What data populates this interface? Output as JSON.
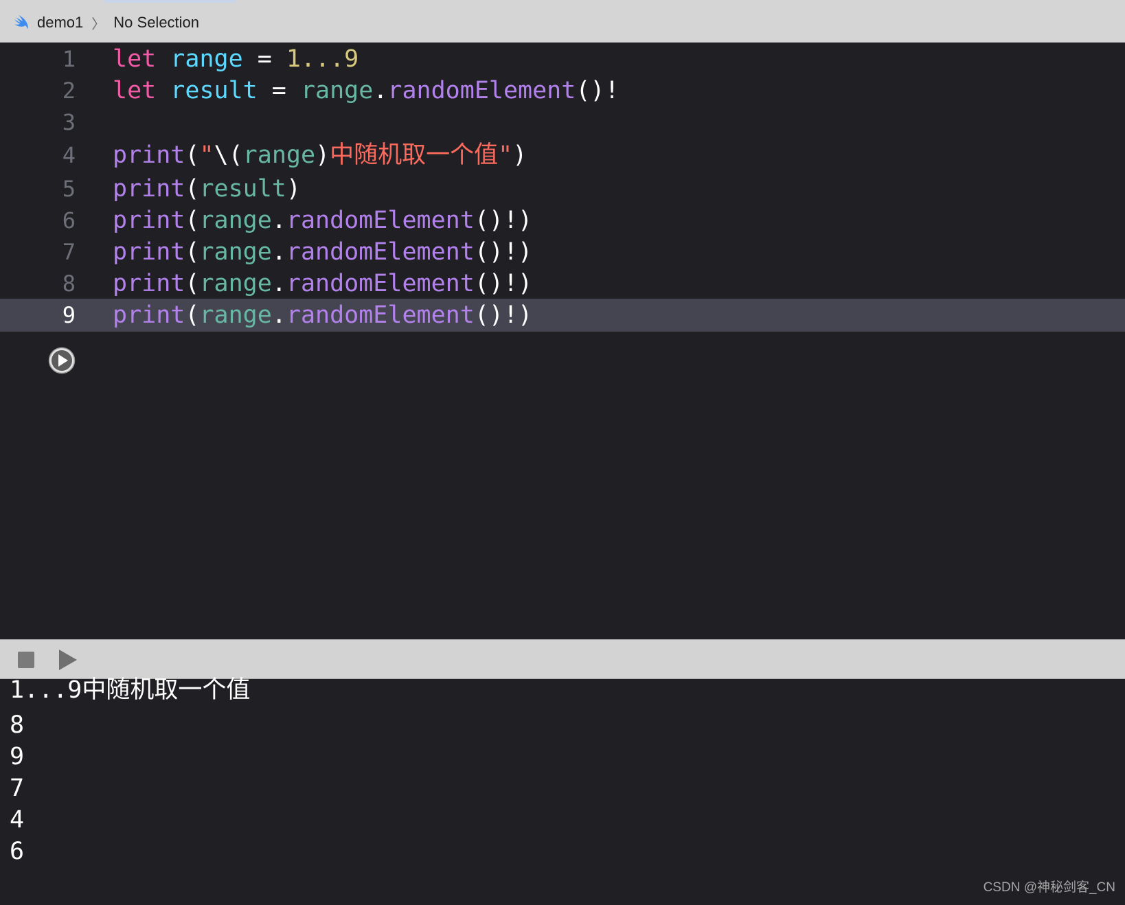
{
  "breadcrumb": {
    "icon": "swift-icon",
    "project": "demo1",
    "separator": "〉",
    "selection": "No Selection"
  },
  "editor": {
    "current_line": 9,
    "lines": [
      {
        "number": "1",
        "tokens": [
          {
            "t": "let",
            "c": "kw"
          },
          {
            "t": " ",
            "c": "plain"
          },
          {
            "t": "range",
            "c": "decl"
          },
          {
            "t": " = ",
            "c": "plain"
          },
          {
            "t": "1...9",
            "c": "num"
          }
        ]
      },
      {
        "number": "2",
        "tokens": [
          {
            "t": "let",
            "c": "kw"
          },
          {
            "t": " ",
            "c": "plain"
          },
          {
            "t": "result",
            "c": "decl"
          },
          {
            "t": " = ",
            "c": "plain"
          },
          {
            "t": "range",
            "c": "var"
          },
          {
            "t": ".",
            "c": "plain"
          },
          {
            "t": "randomElement",
            "c": "fn"
          },
          {
            "t": "()!",
            "c": "plain"
          }
        ]
      },
      {
        "number": "3",
        "tokens": []
      },
      {
        "number": "4",
        "tokens": [
          {
            "t": "print",
            "c": "fn"
          },
          {
            "t": "(",
            "c": "plain"
          },
          {
            "t": "\"",
            "c": "str"
          },
          {
            "t": "\\(",
            "c": "plain"
          },
          {
            "t": "range",
            "c": "var"
          },
          {
            "t": ")",
            "c": "plain"
          },
          {
            "t": "中随机取一个值\"",
            "c": "str"
          },
          {
            "t": ")",
            "c": "plain"
          }
        ]
      },
      {
        "number": "5",
        "tokens": [
          {
            "t": "print",
            "c": "fn"
          },
          {
            "t": "(",
            "c": "plain"
          },
          {
            "t": "result",
            "c": "var"
          },
          {
            "t": ")",
            "c": "plain"
          }
        ]
      },
      {
        "number": "6",
        "tokens": [
          {
            "t": "print",
            "c": "fn"
          },
          {
            "t": "(",
            "c": "plain"
          },
          {
            "t": "range",
            "c": "var"
          },
          {
            "t": ".",
            "c": "plain"
          },
          {
            "t": "randomElement",
            "c": "fn"
          },
          {
            "t": "()!)",
            "c": "plain"
          }
        ]
      },
      {
        "number": "7",
        "tokens": [
          {
            "t": "print",
            "c": "fn"
          },
          {
            "t": "(",
            "c": "plain"
          },
          {
            "t": "range",
            "c": "var"
          },
          {
            "t": ".",
            "c": "plain"
          },
          {
            "t": "randomElement",
            "c": "fn"
          },
          {
            "t": "()!)",
            "c": "plain"
          }
        ]
      },
      {
        "number": "8",
        "tokens": [
          {
            "t": "print",
            "c": "fn"
          },
          {
            "t": "(",
            "c": "plain"
          },
          {
            "t": "range",
            "c": "var"
          },
          {
            "t": ".",
            "c": "plain"
          },
          {
            "t": "randomElement",
            "c": "fn"
          },
          {
            "t": "()!)",
            "c": "plain"
          }
        ]
      },
      {
        "number": "9",
        "tokens": [
          {
            "t": "print",
            "c": "fn"
          },
          {
            "t": "(",
            "c": "plain"
          },
          {
            "t": "range",
            "c": "var"
          },
          {
            "t": ".",
            "c": "plain"
          },
          {
            "t": "randomElement",
            "c": "fn"
          },
          {
            "t": "()!)",
            "c": "plain"
          }
        ]
      }
    ]
  },
  "debug": {
    "stop_icon": "stop-icon",
    "run_icon": "play-icon"
  },
  "console": {
    "output": [
      "1...9中随机取一个值",
      "8",
      "9",
      "7",
      "4",
      "6"
    ]
  },
  "watermark": "CSDN @神秘剑客_CN",
  "colors": {
    "editor_bg": "#1f1f24",
    "keyword": "#f15aa4",
    "declaration": "#5dd8ff",
    "number": "#d9c97c",
    "variable": "#67b7a4",
    "function": "#b281eb",
    "string": "#fc6a5d",
    "current_line": "#444551"
  }
}
